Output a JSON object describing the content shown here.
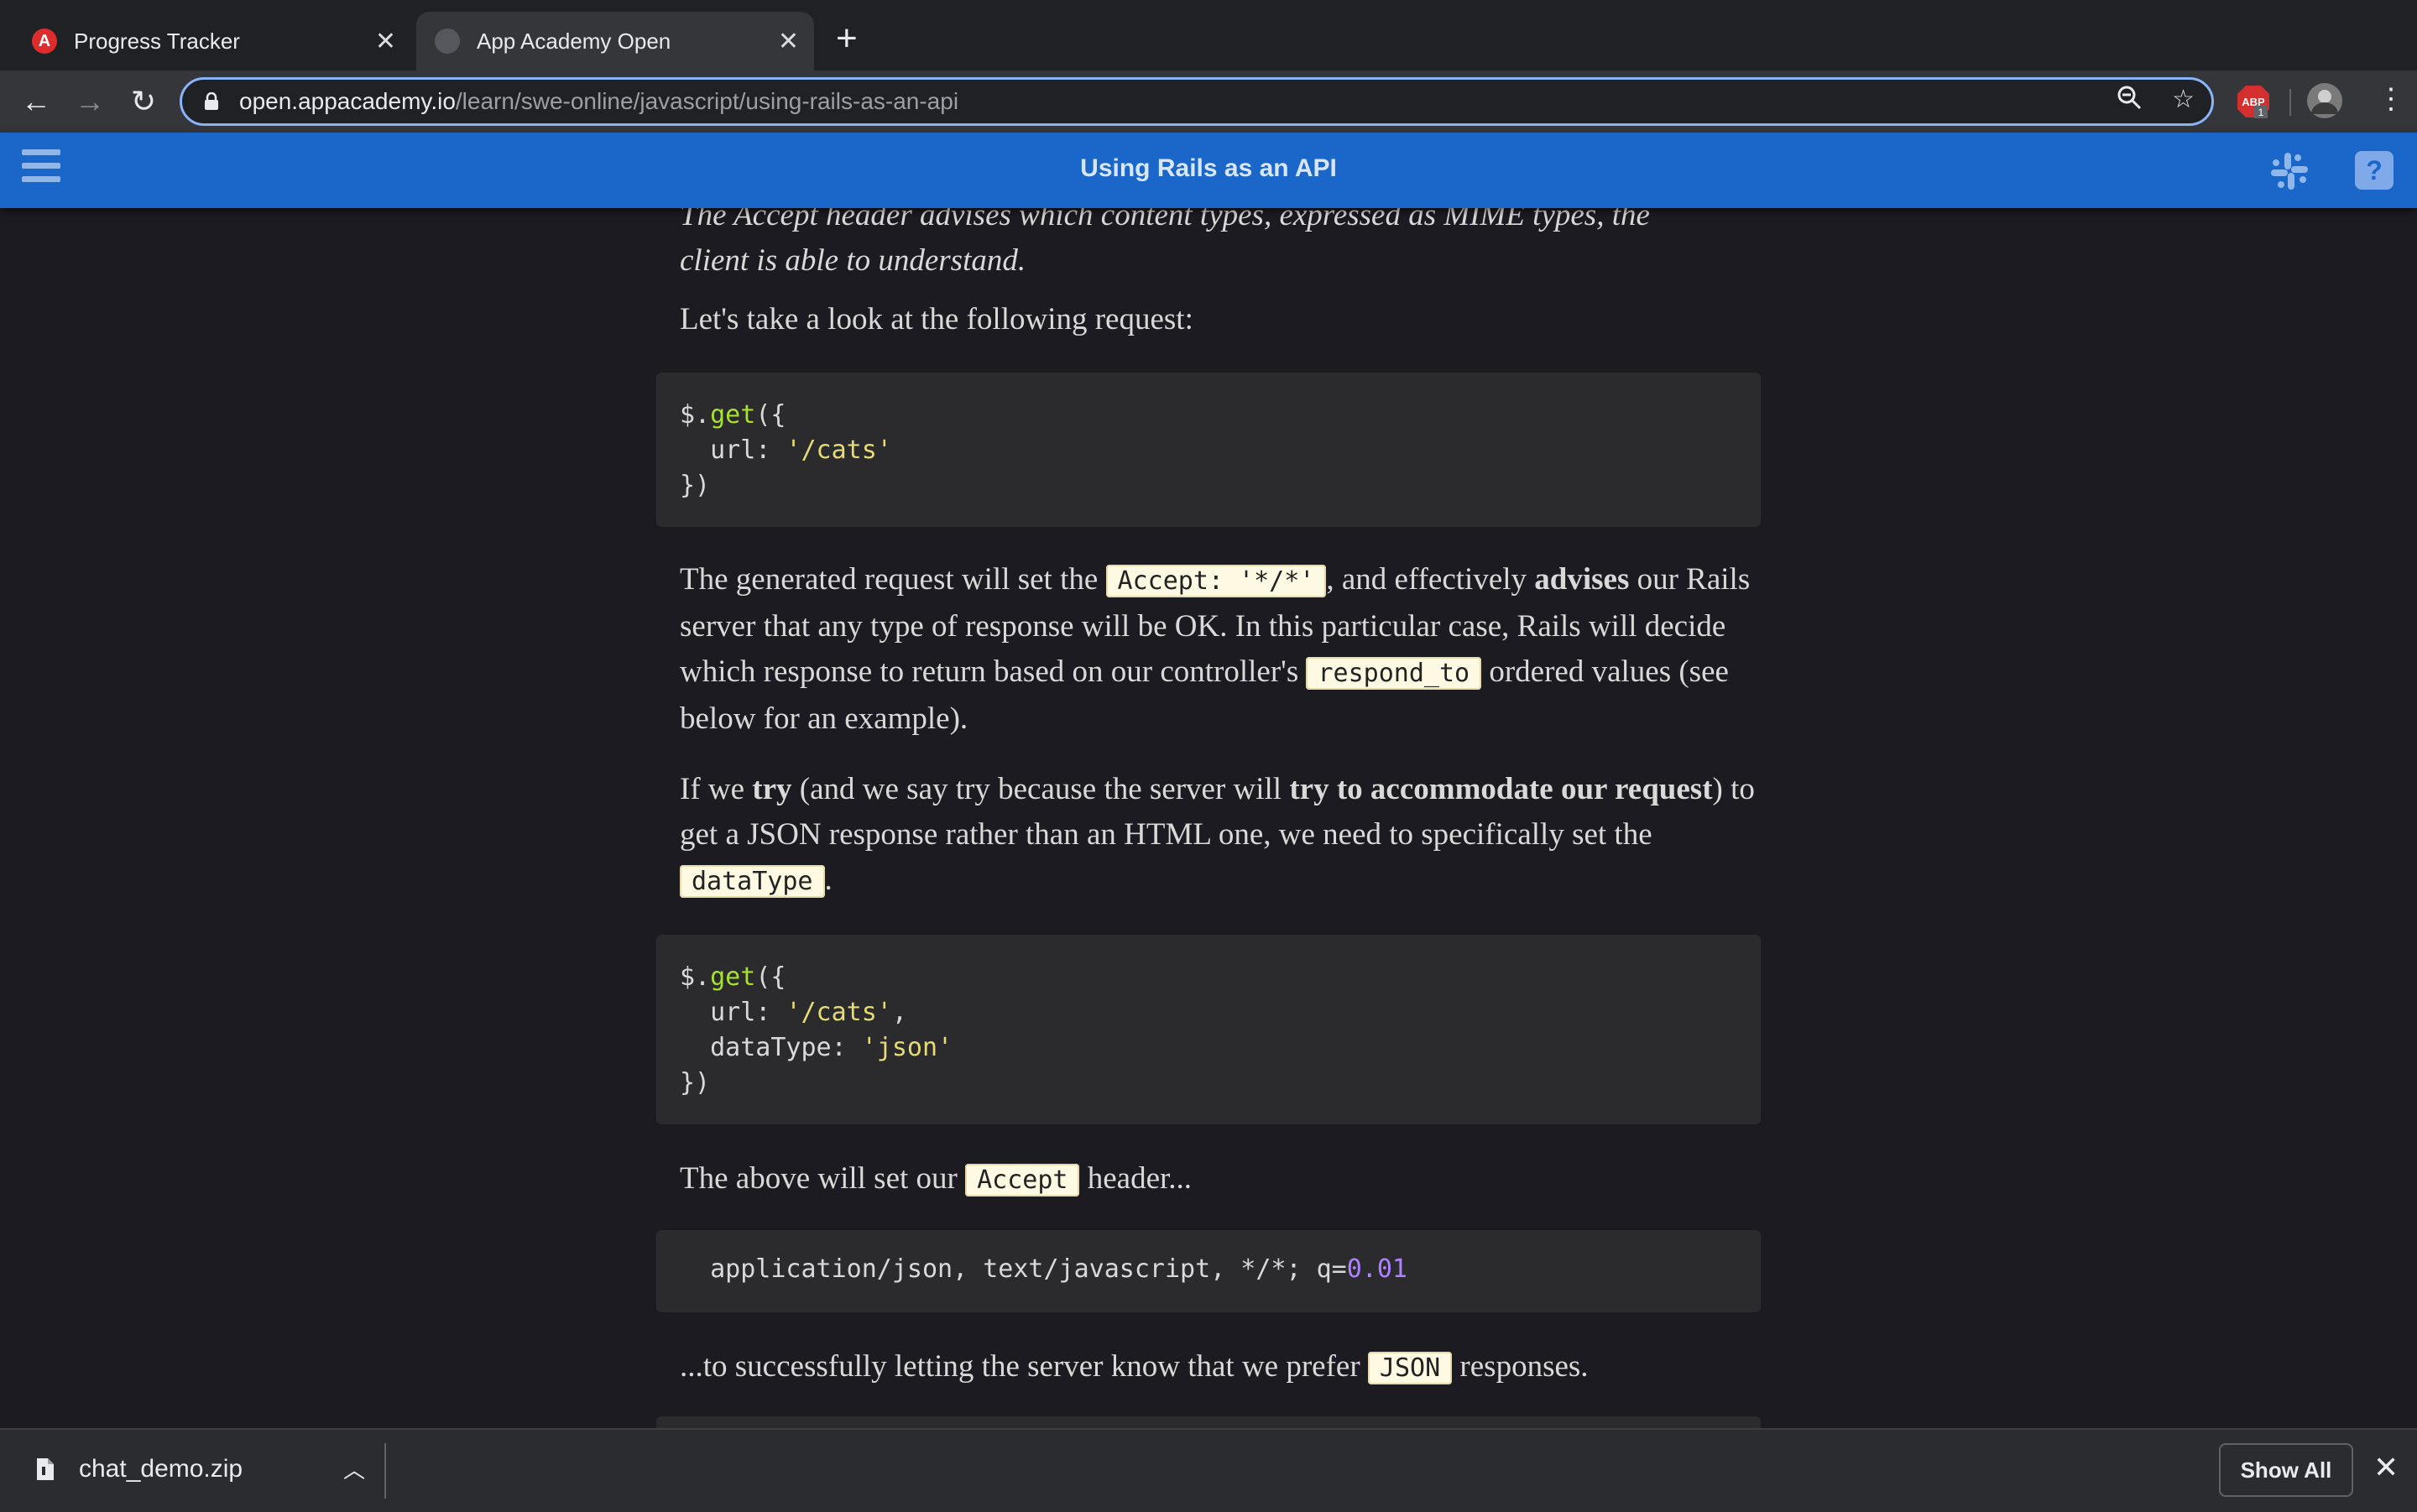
{
  "browser": {
    "tabs": [
      {
        "title": "Progress Tracker",
        "favicon": "A",
        "active": false
      },
      {
        "title": "App Academy Open",
        "active": true
      }
    ],
    "url_host": "open.appacademy.io",
    "url_path": "/learn/swe-online/javascript/using-rails-as-an-api",
    "extension_badge": "1",
    "extension_label": "ABP"
  },
  "app": {
    "title": "Using Rails as an API",
    "help_label": "?"
  },
  "article": {
    "partial_line": "The Accept header advises which content types, expressed as MIME types, the",
    "partial_line2": "client is able to understand.",
    "intro": "Let's take a look at the following request:",
    "code1": {
      "l1a": "$.",
      "l1b": "get",
      "l1c": "({",
      "l2a": "  url: ",
      "l2b": "'/cats'",
      "l3": "})"
    },
    "p2": {
      "t1": "The generated request will set the ",
      "code1": "Accept: '*/*'",
      "t2": ", and effectively ",
      "b1": "advises",
      "t3": " our Rails server that any type of response will be OK. In this particular case, Rails will decide which response to return based on our controller's ",
      "code2": "respond_to",
      "t4": " ordered values (see below for an example)."
    },
    "p3": {
      "t1": "If we ",
      "b1": "try",
      "t2": " (and we say try because the server will ",
      "b2": "try to accommodate our request",
      "t3": ") to get a JSON response rather than an HTML one, we need to specifically set the ",
      "code1": "dataType",
      "t4": "."
    },
    "code2": {
      "l1a": "$.",
      "l1b": "get",
      "l1c": "({",
      "l2a": "  url: ",
      "l2b": "'/cats'",
      "l2c": ",",
      "l3a": "  dataType: ",
      "l3b": "'json'",
      "l4": "})"
    },
    "p4": {
      "t1": "The above will set our ",
      "code1": "Accept",
      "t2": " header..."
    },
    "code3": {
      "a": "  application/json, text/javascript, */*; q=",
      "b": "0.01"
    },
    "p5": {
      "t1": "...to successfully letting the server know that we prefer ",
      "code1": "JSON",
      "t2": " responses."
    }
  },
  "downloads": {
    "file": "chat_demo.zip",
    "show_all": "Show All"
  }
}
